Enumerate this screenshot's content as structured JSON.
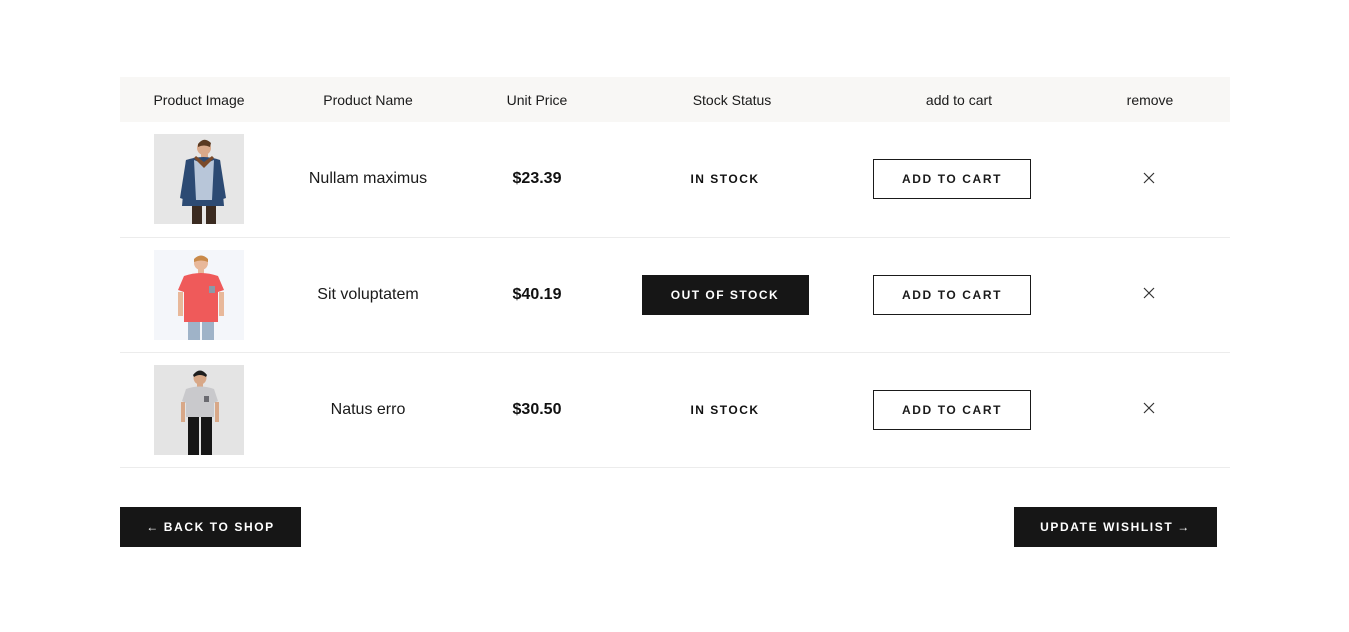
{
  "table": {
    "headers": {
      "image": "Product Image",
      "name": "Product Name",
      "price": "Unit Price",
      "stock": "Stock Status",
      "cart": "add to cart",
      "remove": "remove"
    },
    "rows": [
      {
        "name": "Nullam maximus",
        "price": "$23.39",
        "stock": "IN STOCK",
        "stock_state": "in",
        "add_to_cart": "ADD TO CART"
      },
      {
        "name": "Sit voluptatem",
        "price": "$40.19",
        "stock": "OUT OF STOCK",
        "stock_state": "out",
        "add_to_cart": "ADD TO CART"
      },
      {
        "name": "Natus erro",
        "price": "$30.50",
        "stock": "IN STOCK",
        "stock_state": "in",
        "add_to_cart": "ADD TO CART"
      }
    ]
  },
  "actions": {
    "back_arrow": "←",
    "back_label": "BACK TO SHOP",
    "update_label": "UPDATE WISHLIST",
    "update_arrow": "→"
  },
  "icons": {
    "remove": "close-icon",
    "back": "arrow-left-icon",
    "update": "arrow-right-icon"
  },
  "colors": {
    "header_bg": "#f8f7f5",
    "dark_button": "#161616",
    "border": "#ececec"
  }
}
